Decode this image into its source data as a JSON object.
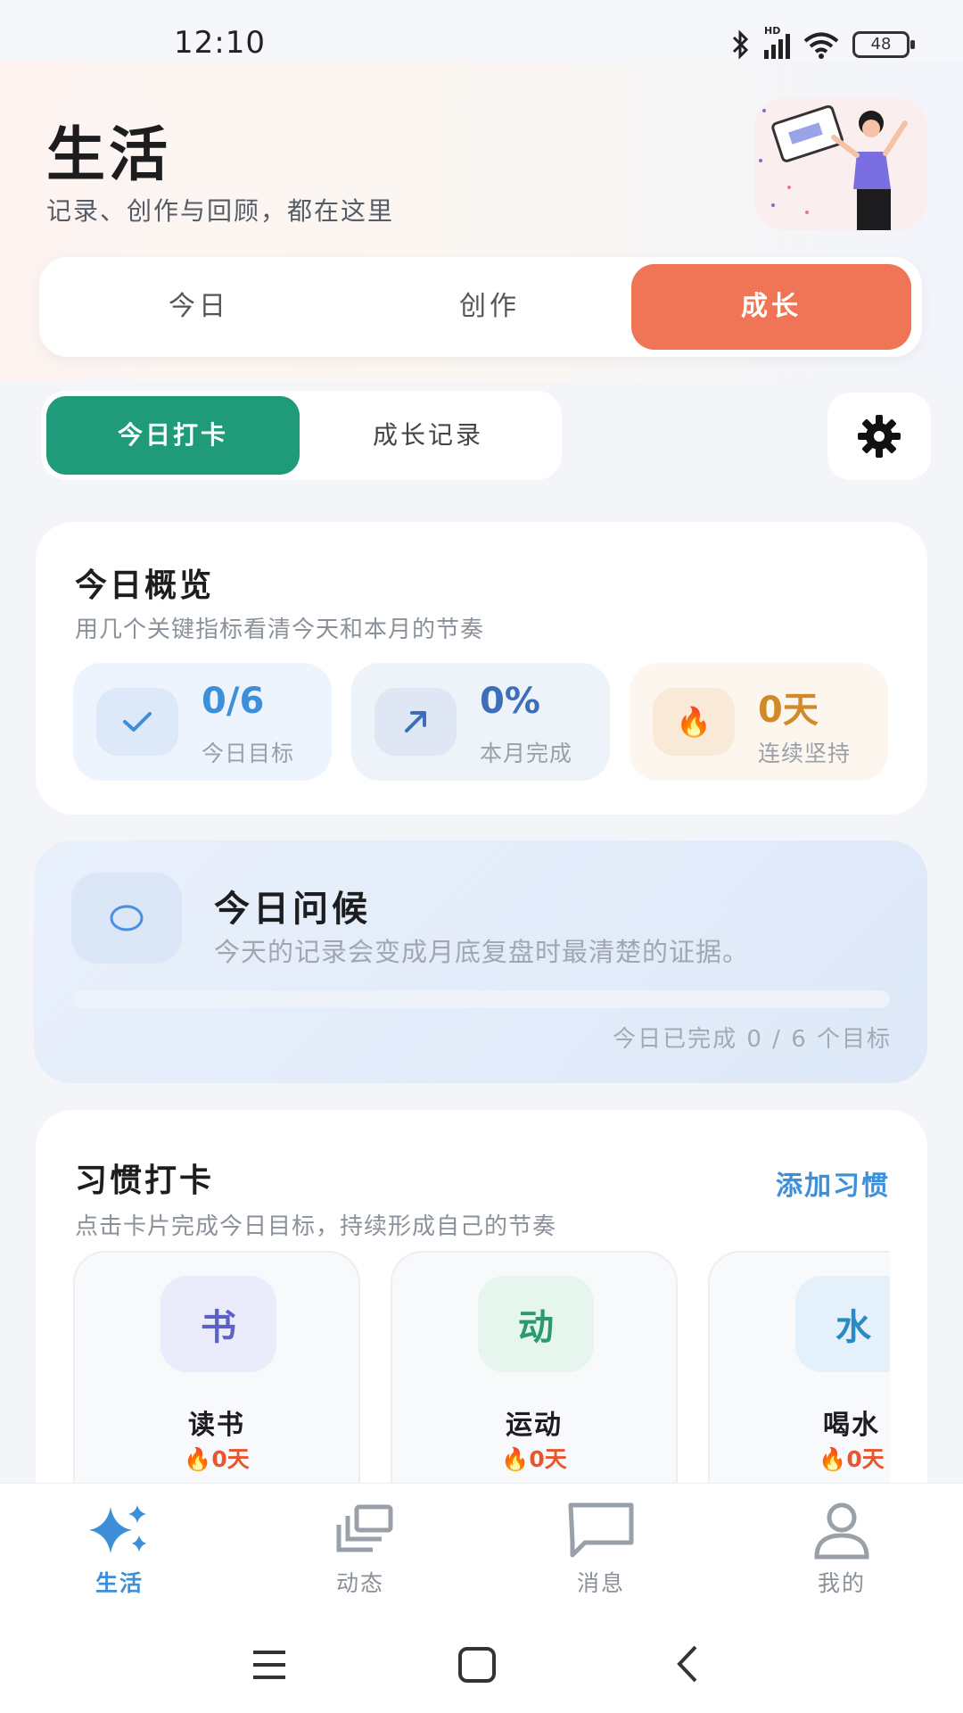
{
  "status_bar": {
    "time": "12:10",
    "network_label": "HD",
    "battery": "48"
  },
  "header": {
    "title": "生活",
    "subtitle": "记录、创作与回顾，都在这里"
  },
  "segment_tabs": [
    {
      "label": "今日",
      "active": false
    },
    {
      "label": "创作",
      "active": false
    },
    {
      "label": "成长",
      "active": true
    }
  ],
  "sub_tabs": [
    {
      "label": "今日打卡",
      "active": true
    },
    {
      "label": "成长记录",
      "active": false
    }
  ],
  "overview": {
    "title": "今日概览",
    "subtitle": "用几个关键指标看清今天和本月的节奏",
    "stats": [
      {
        "value": "0/6",
        "label": "今日目标",
        "icon": "check-icon",
        "color": "#3d8fd9",
        "bg": "#edf4fd"
      },
      {
        "value": "0%",
        "label": "本月完成",
        "icon": "trend-arrow-icon",
        "color": "#3d6fb8",
        "bg": "#eef3fa"
      },
      {
        "value": "0天",
        "label": "连续坚持",
        "icon": "fire-icon",
        "color": "#d08a2a",
        "bg": "#fdf6ee"
      }
    ]
  },
  "greeting": {
    "title": "今日问候",
    "text": "今天的记录会变成月底复盘时最清楚的证据。",
    "progress_fraction": 0,
    "progress_text": "今日已完成 0 / 6 个目标"
  },
  "habits": {
    "title": "习惯打卡",
    "subtitle": "点击卡片完成今日目标，持续形成自己的节奏",
    "add_label": "添加习惯",
    "items": [
      {
        "glyph": "书",
        "name": "读书",
        "streak": "🔥0天",
        "color": "#5a62c8",
        "bg": "#ecebfb"
      },
      {
        "glyph": "动",
        "name": "运动",
        "streak": "🔥0天",
        "color": "#2a9a6e",
        "bg": "#e6f5ee"
      },
      {
        "glyph": "水",
        "name": "喝水",
        "streak": "🔥0天",
        "color": "#2a8ac6",
        "bg": "#e4f1fb"
      }
    ]
  },
  "bottom_nav": [
    {
      "label": "生活",
      "icon": "sparkle-icon",
      "active": true
    },
    {
      "label": "动态",
      "icon": "stack-icon",
      "active": false
    },
    {
      "label": "消息",
      "icon": "chat-bubble-icon",
      "active": false
    },
    {
      "label": "我的",
      "icon": "person-icon",
      "active": false
    }
  ],
  "colors": {
    "accent_orange": "#f07556",
    "accent_green": "#1f9b7a",
    "accent_blue": "#3d8fd9"
  }
}
